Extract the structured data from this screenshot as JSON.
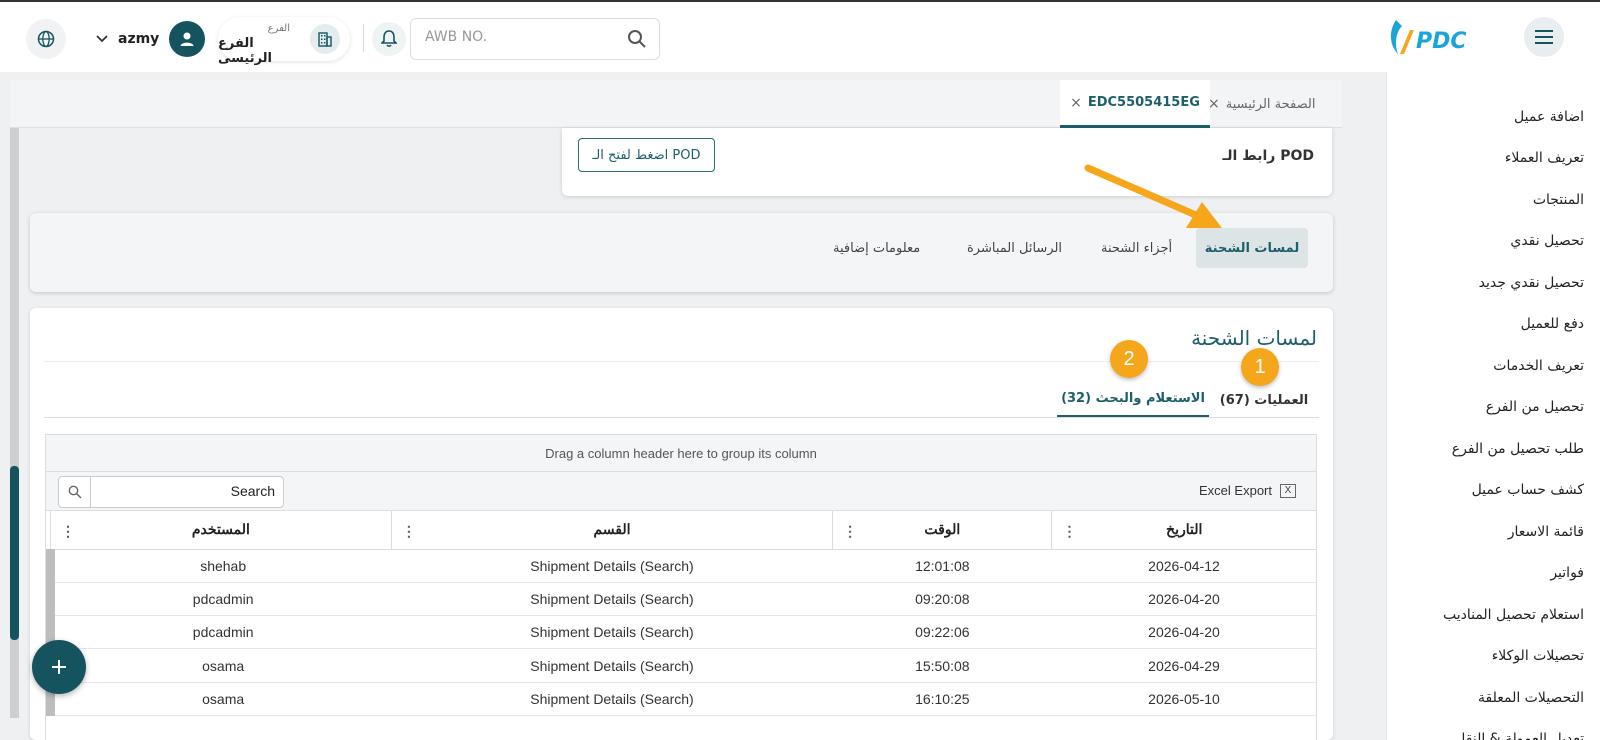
{
  "header": {
    "logo_text": "PDC",
    "awb_placeholder": "AWB NO.",
    "branch_caption": "الفرع",
    "branch_name": "الفرع الرئيسى",
    "username": "azmy"
  },
  "sidebar": {
    "items": [
      {
        "label": "اضافة عميل"
      },
      {
        "label": "تعريف العملاء"
      },
      {
        "label": "المنتجات"
      },
      {
        "label": "تحصيل نقدي"
      },
      {
        "label": "تحصيل نقدي جديد"
      },
      {
        "label": "دفع للعميل"
      },
      {
        "label": "تعريف الخدمات"
      },
      {
        "label": "تحصيل من الفرع"
      },
      {
        "label": "طلب تحصيل من الفرع"
      },
      {
        "label": "كشف حساب عميل"
      },
      {
        "label": "قائمة الاسعار"
      },
      {
        "label": "فواتير"
      },
      {
        "label": "استعلام تحصيل المناديب"
      },
      {
        "label": "تحصيلات الوكلاء"
      },
      {
        "label": "التحصيلات المعلقة"
      },
      {
        "label": "تعديل العمولة & النقل"
      }
    ]
  },
  "tabs": {
    "home": "الصفحة الرئيسية",
    "awb": "EDC5505415EG",
    "close_glyph": "×"
  },
  "pod": {
    "label": "رابط الـ POD",
    "button": "اضغط لفتح الـ POD"
  },
  "subtabs": [
    "لمسات الشحنة",
    "أجزاء الشحنة",
    "الرسائل المباشرة",
    "معلومات إضافية"
  ],
  "main": {
    "title": "لمسات الشحنة",
    "tab_ops": "العمليات (67)",
    "tab_inquiry": "الاستعلام والبحث (32)",
    "badge1": "1",
    "badge2": "2"
  },
  "grid": {
    "group_hint": "Drag a column header here to group its column",
    "search_placeholder": "Search",
    "excel_label": "Excel Export",
    "excel_icon": "X",
    "kebab": "⋮",
    "columns": {
      "date": "التاريخ",
      "time": "الوقت",
      "section": "القسم",
      "user": "المستخدم"
    },
    "rows": [
      {
        "date": "2026-04-12",
        "time": "12:01:08",
        "section": "Shipment Details (Search)",
        "user": "shehab"
      },
      {
        "date": "2026-04-20",
        "time": "09:20:08",
        "section": "Shipment Details (Search)",
        "user": "pdcadmin"
      },
      {
        "date": "2026-04-20",
        "time": "09:22:06",
        "section": "Shipment Details (Search)",
        "user": "pdcadmin"
      },
      {
        "date": "2026-04-29",
        "time": "15:50:08",
        "section": "Shipment Details (Search)",
        "user": "osama"
      },
      {
        "date": "2026-05-10",
        "time": "16:10:25",
        "section": "Shipment Details (Search)",
        "user": "osama"
      }
    ]
  },
  "icons": {
    "menu": "hamburger-icon",
    "globe": "globe-icon",
    "user": "user-icon",
    "building": "building-icon",
    "bell": "bell-icon",
    "search": "search-icon",
    "plus": "plus-icon"
  },
  "colors": {
    "brand": "#15545f",
    "accent": "#f5a61b",
    "logo_blue": "#1aa5d6"
  }
}
